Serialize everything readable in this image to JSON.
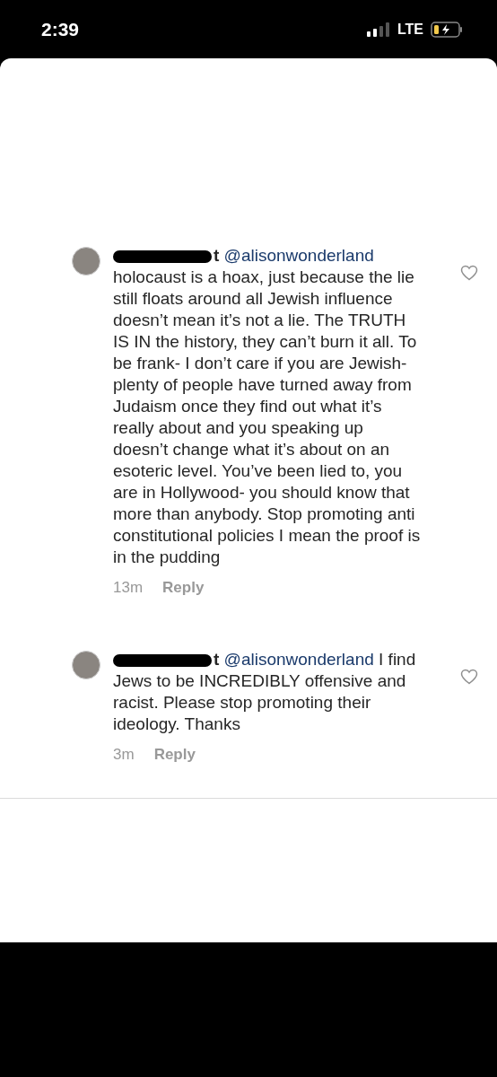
{
  "status_bar": {
    "time": "2:39",
    "network": "LTE"
  },
  "comments": [
    {
      "username_visible": "t",
      "mention": "@alisonwonderland",
      "text": "holocaust is a hoax, just because the lie still floats around all Jewish influence doesn’t mean it’s not a lie. The TRUTH IS IN the history, they can’t burn it all. To be frank- I don’t care if you are Jewish- plenty of people have turned away from Judaism once they find out what it’s really about and you speaking up doesn’t change what it’s about on an esoteric level. You’ve been lied to, you are in Hollywood- you should know that more than anybody. Stop promoting anti constitutional policies I mean the proof is in the pudding",
      "time": "13m",
      "reply": "Reply",
      "liked": false
    },
    {
      "username_visible": "t",
      "mention": "@alisonwonderland",
      "text": "I find Jews to be INCREDIBLY offensive and racist. Please stop promoting their ideology. Thanks",
      "time": "3m",
      "reply": "Reply",
      "liked": false
    }
  ]
}
